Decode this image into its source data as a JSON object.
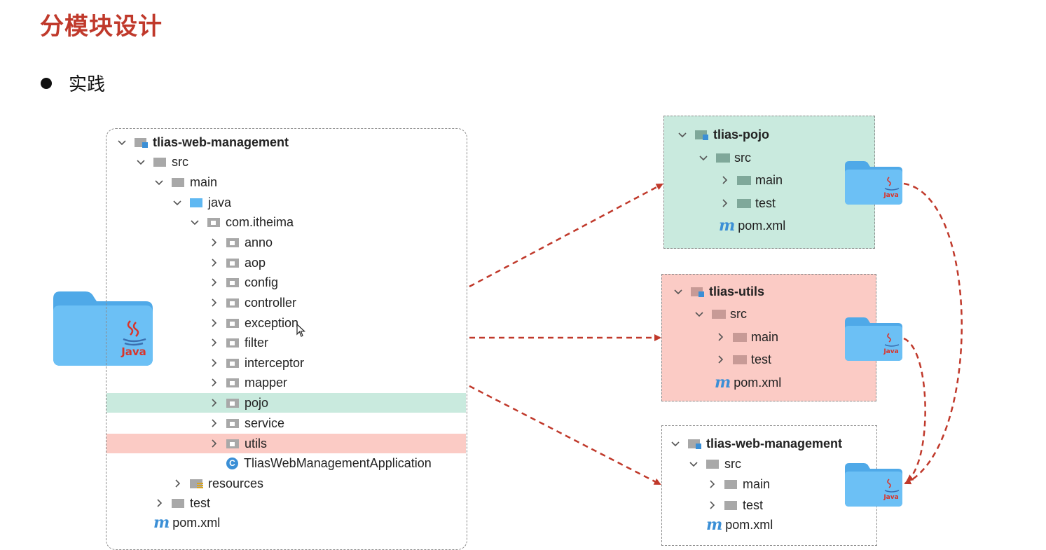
{
  "title": "分模块设计",
  "bullet": "实践",
  "left_tree": {
    "root": "tlias-web-management",
    "src": "src",
    "main": "main",
    "java": "java",
    "package": "com.itheima",
    "packages": [
      "anno",
      "aop",
      "config",
      "controller",
      "exception",
      "filter",
      "interceptor",
      "mapper",
      "pojo",
      "service",
      "utils"
    ],
    "app_class": "TliasWebManagementApplication",
    "resources": "resources",
    "test": "test",
    "pom": "pom.xml"
  },
  "pojo_module": {
    "root": "tlias-pojo",
    "src": "src",
    "main": "main",
    "test": "test",
    "pom": "pom.xml"
  },
  "utils_module": {
    "root": "tlias-utils",
    "src": "src",
    "main": "main",
    "test": "test",
    "pom": "pom.xml"
  },
  "web_module": {
    "root": "tlias-web-management",
    "src": "src",
    "main": "main",
    "test": "test",
    "pom": "pom.xml"
  },
  "java_folder_label": "Java",
  "colors": {
    "title": "#c0392b",
    "pojo_highlight": "#c9eade",
    "utils_highlight": "#fbcbc5",
    "arrow": "#c0392b",
    "folder_blue": "#5fb8f2"
  }
}
